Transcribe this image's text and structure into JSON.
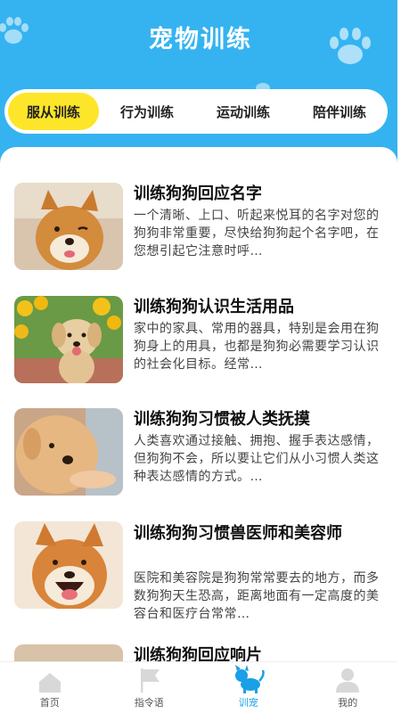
{
  "header": {
    "title": "宠物训练"
  },
  "tabs": [
    {
      "label": "服从训练",
      "active": true
    },
    {
      "label": "行为训练",
      "active": false
    },
    {
      "label": "运动训练",
      "active": false
    },
    {
      "label": "陪伴训练",
      "active": false
    }
  ],
  "items": [
    {
      "title": "训练狗狗回应名字",
      "desc": "一个清晰、上口、听起来悦耳的名字对您的狗狗非常重要，尽快给狗狗起个名字吧，在您想引起它注意时呼…"
    },
    {
      "title": "训练狗狗认识生活用品",
      "desc": "家中的家具、常用的器具，特别是会用在狗狗身上的用具，也都是狗狗必需要学习认识的社会化目标。经常…"
    },
    {
      "title": "训练狗狗习惯被人类抚摸",
      "desc": "人类喜欢通过接触、拥抱、握手表达感情，但狗狗不会，所以要让它们从小习惯人类这种表达感情的方式。…"
    },
    {
      "title": "训练狗狗习惯兽医师和美容师",
      "desc": "医院和美容院是狗狗常常要去的地方，而多数狗狗天生恐高，距离地面有一定高度的美容台和医疗台常常…"
    },
    {
      "title": "训练狗狗回应响片",
      "desc": ""
    }
  ],
  "nav": [
    {
      "label": "首页",
      "icon": "home-icon",
      "active": false
    },
    {
      "label": "指令语",
      "icon": "flag-icon",
      "active": false
    },
    {
      "label": "训宠",
      "icon": "dog-icon",
      "active": true
    },
    {
      "label": "我的",
      "icon": "user-icon",
      "active": false
    }
  ],
  "colors": {
    "primary": "#35b3f0",
    "tab_active": "#fde529",
    "nav_active": "#1aa0e6"
  }
}
